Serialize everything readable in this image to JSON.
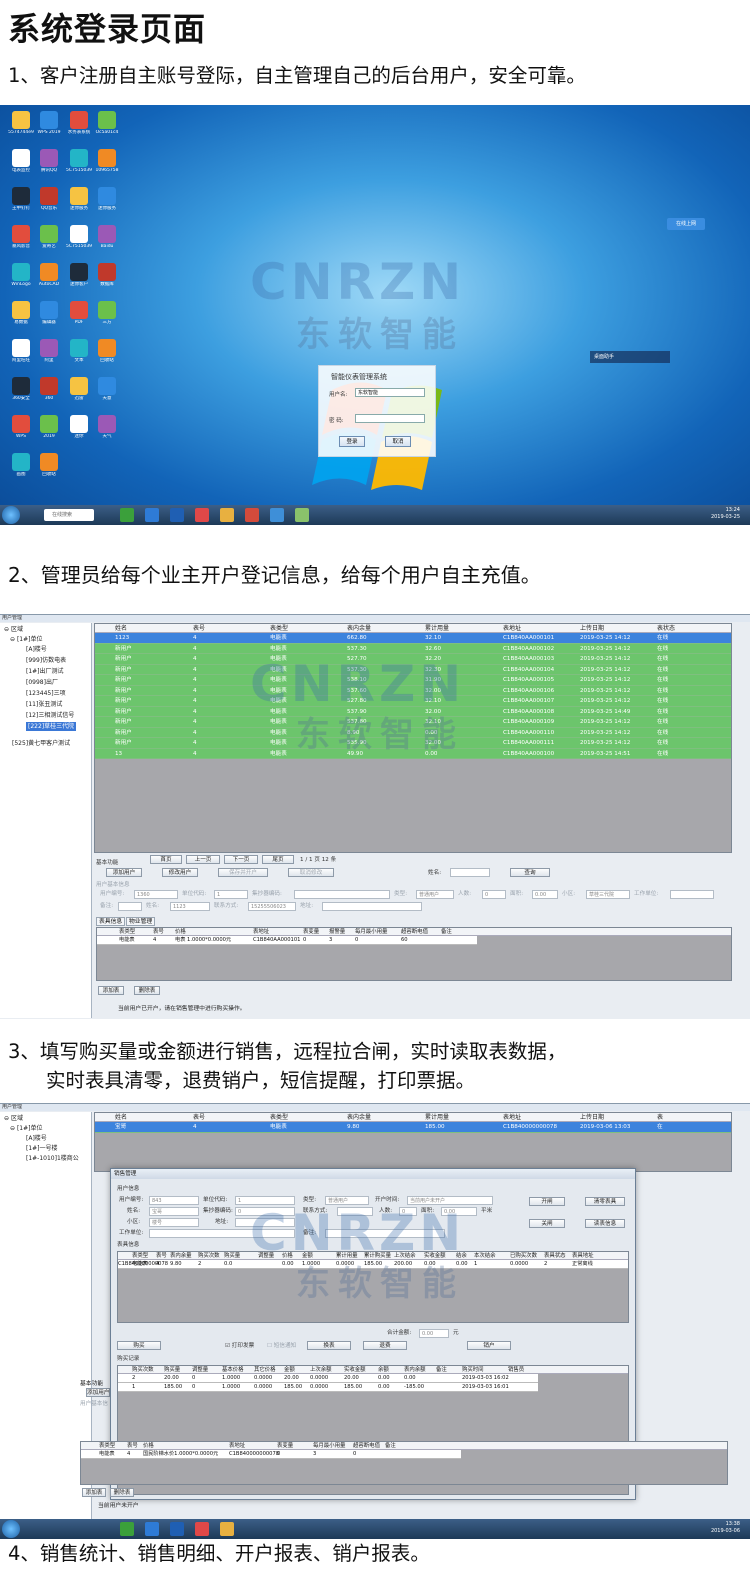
{
  "page": {
    "title": "系统登录页面",
    "step1": "1、客户注册自主账号登际，自主管理自己的后台用户，安全可靠。",
    "step2": "2、管理员给每个业主开户登记信息，给每个用户自主充值。",
    "step3_line1": "3、填写购买量或金额进行销售，远程拉合闸，实时读取表数据，",
    "step3_line2": "实时表具清零，退费销户，短信提醒，打印票据。",
    "step4": "4、销售统计、销售明细、开户报表、销户报表。"
  },
  "watermark": {
    "en": "CNRZN",
    "cn": "东软智能"
  },
  "colors": {
    "selected_row": "#3c83dd",
    "ok_row": "#6cc56c",
    "grid_bg": "#a7a7ab",
    "desktop": "#1a6fc4"
  },
  "desktop": {
    "login": {
      "title": "智能仪表管理系统",
      "user_label": "用户名:",
      "user_value": "东软智能",
      "pwd_label": "密  码:",
      "ok_button": "登录",
      "cancel_button": "取消"
    },
    "widget": "桌面助手",
    "top_button": "在线上网",
    "search_text": "在线搜索",
    "clock_time": "13:24",
    "clock_date": "2019-03-25",
    "icons": [
      "5574744e9",
      "WPS 2019",
      "水务表系统",
      "Oc5a01c4",
      "电表监控",
      "腾讯QQ",
      "5C7515039",
      "10965758",
      "王中钉钉",
      "QQ音乐",
      "迷你服务",
      "迷你服务",
      "暴风影音",
      "爱奇艺",
      "5C7515039",
      "Baidu",
      "WinLogo",
      "AutoCAD",
      "迷你客户",
      "数据库",
      "易数据",
      "编辑器",
      "PDF",
      "三方",
      "阿里旺旺",
      "阿里",
      "文本",
      "回收站",
      "360安全",
      "360",
      "迅雷",
      "天意",
      "WPS",
      "2019",
      "迷你",
      "天气",
      "画图",
      "回收站"
    ]
  },
  "app2": {
    "window_title": "用户管理",
    "tree": {
      "root": "区域",
      "unit": "[1#]单位",
      "items": [
        "[A]楼号",
        "[999]仿数电表",
        "[1#]出厂测试",
        "[0998]出厂",
        "[123445]三项",
        "[11]张丑测试",
        "[12]三相测试信号",
        "[222]草桂三代院"
      ],
      "extra": "[525]黄七甲客户测试"
    },
    "columns": [
      "姓名",
      "表号",
      "表类型",
      "表内余量",
      "累计用量",
      "表地址",
      "上传日期",
      "表状态"
    ],
    "rows": [
      [
        "1123",
        "4",
        "电能表",
        "662.80",
        "32.10",
        "C1B840AA000101",
        "2019-03-25 14:12",
        "在线"
      ],
      [
        "新用户",
        "4",
        "电能表",
        "537.30",
        "32.60",
        "C1B840AA000102",
        "2019-03-25 14:12",
        "在线"
      ],
      [
        "新用户",
        "4",
        "电能表",
        "527.70",
        "32.20",
        "C1B840AA000103",
        "2019-03-25 14:12",
        "在线"
      ],
      [
        "新用户",
        "4",
        "电能表",
        "537.30",
        "32.30",
        "C1B840AA000104",
        "2019-03-25 14:12",
        "在线"
      ],
      [
        "新用户",
        "4",
        "电能表",
        "538.10",
        "31.90",
        "C1B840AA000105",
        "2019-03-25 14:12",
        "在线"
      ],
      [
        "新用户",
        "4",
        "电能表",
        "537.60",
        "32.00",
        "C1B840AA000106",
        "2019-03-25 14:12",
        "在线"
      ],
      [
        "新用户",
        "4",
        "电能表",
        "527.80",
        "32.10",
        "C1B840AA000107",
        "2019-03-25 14:12",
        "在线"
      ],
      [
        "新用户",
        "4",
        "电能表",
        "537.90",
        "32.00",
        "C1B840AA000108",
        "2019-03-25 14:49",
        "在线"
      ],
      [
        "新用户",
        "4",
        "电能表",
        "537.80",
        "32.10",
        "C1B840AA000109",
        "2019-03-25 14:12",
        "在线"
      ],
      [
        "新用户",
        "4",
        "电能表",
        "8.90",
        "0.00",
        "C1B840AA000110",
        "2019-03-25 14:12",
        "在线"
      ],
      [
        "新用户",
        "4",
        "电能表",
        "535.90",
        "32.00",
        "C1B840AA000111",
        "2019-03-25 14:12",
        "在线"
      ],
      [
        "13",
        "4",
        "电能表",
        "49.90",
        "0.00",
        "C1B840AA000100",
        "2019-03-25 14:51",
        "在线"
      ]
    ],
    "pager": {
      "first": "首页",
      "prev": "上一页",
      "next": "下一页",
      "last": "尾页",
      "info": "1 / 1 页 12 条"
    },
    "basic": {
      "section": "基本功能",
      "add_user": "添加用户",
      "edit_user": "修改用户",
      "save_open": "保存并开户",
      "cancel_edit": "取消修改",
      "name_label": "姓名:",
      "query": "查询"
    },
    "form": {
      "section": "用户基本信息",
      "user_no_label": "用户编号:",
      "user_no": "1360",
      "unit_code_label": "单位代码:",
      "unit_code": "1",
      "unit_label": "集抄器编码:",
      "type_label": "类型:",
      "type_value": "普通用户",
      "people_label": "人数:",
      "people": "0",
      "area_label": "面积:",
      "area": "0.00",
      "district_label": "小区:",
      "district": "草桂三代院",
      "work_label": "工作单位:",
      "note_label": "备注:",
      "name_label": "姓名:",
      "name": "1123",
      "contact_label": "联系方式:",
      "contact": "15255506023",
      "addr_label": "地址:"
    },
    "meter_tabs": [
      "表具信息",
      "物业管理"
    ],
    "meter_columns": [
      "表类型",
      "表号",
      "价格",
      "表地址",
      "表变量",
      "报警量",
      "每月最小用量",
      "超容断电值",
      "备注"
    ],
    "meter_row": [
      "电能表",
      "4",
      "电表 1.0000*0.0000元",
      "C1B840AA000101",
      "0",
      "3",
      "0",
      "60",
      ""
    ],
    "add_meter": "添加表",
    "delete_meter": "删除表",
    "status": "当前用户已开户，请在销售管理中进行购买操作。"
  },
  "app3": {
    "window_title": "用户管理",
    "tree": {
      "root": "区域",
      "unit": "[1#]单位",
      "items": [
        "[A]楼号",
        "[1#]一号楼",
        "[1#-1010]1楼商公"
      ]
    },
    "columns": [
      "姓名",
      "表号",
      "表类型",
      "表内余量",
      "累计用量",
      "表地址",
      "上传日期",
      "表"
    ],
    "row": [
      "宝哥",
      "4",
      "电能表",
      "9.80",
      "185.00",
      "C1B840000000078",
      "2019-03-06 13:03",
      "在"
    ],
    "dialog": {
      "title": "销售管理",
      "user_info": "用户信息",
      "user_no_label": "用户编号:",
      "user_no": "843",
      "unit_code_label": "单位代码:",
      "unit_code": "1",
      "type_label": "类型:",
      "type_value": "普通用户",
      "open_time_label": "开户时间:",
      "open_time": "当前用户未开户",
      "name_label": "姓名:",
      "name": "宝哥",
      "unit_label": "集抄器编码:",
      "unit_value": "0",
      "contact_label": "联系方式:",
      "people_label": "人数:",
      "people": "0",
      "area_label": "面积:",
      "area": "0.00",
      "area_unit": "平米",
      "district_label": "小区:",
      "district": "楼号",
      "addr_label": "地址:",
      "work_label": "工作单位:",
      "note_label": "备注:",
      "open_button": "开闸",
      "clear_button": "清零表具",
      "close_button": "关闸",
      "read_button": "读表信息",
      "meter_info": "表具信息",
      "meter_columns": [
        "表类型",
        "表号",
        "表内余量",
        "购买次数",
        "购买量",
        "调整量",
        "价格",
        "金额",
        "累计用量",
        "累计购买量",
        "上次结余",
        "实收金额",
        "结余",
        "本次结余",
        "已购买次数",
        "表具状态",
        "表具地址"
      ],
      "meter_row": [
        "电能表",
        "4",
        "9.80",
        "2",
        "0.0",
        "",
        "0.00",
        "1.0000",
        "0.0000",
        "185.00",
        "200.00",
        "0.00",
        "0.00",
        "1",
        "0.0000",
        "2",
        "正常离线",
        "C1B840000000078"
      ],
      "total_label": "合计金额:",
      "total_value": "0.00",
      "total_unit": "元",
      "buy_button": "购买",
      "print_label": "打印发票",
      "sms_label": "短信通知",
      "change_meter": "换表",
      "refund": "退费",
      "close_account": "销户",
      "record_label": "购买记录",
      "record_columns": [
        "购买次数",
        "购买量",
        "调整量",
        "基本价格",
        "其它价格",
        "金额",
        "上次余额",
        "实收金额",
        "余额",
        "表内余额",
        "备注",
        "购买时间",
        "销售员"
      ],
      "records": [
        [
          "2",
          "20.00",
          "0",
          "1.0000",
          "0.0000",
          "20.00",
          "0.0000",
          "20.00",
          "0.00",
          "0.00",
          "",
          "2019-03-03 16:02",
          ""
        ],
        [
          "1",
          "185.00",
          "0",
          "1.0000",
          "0.0000",
          "185.00",
          "0.0000",
          "185.00",
          "0.00",
          "-185.00",
          "",
          "2019-03-03 16:01",
          ""
        ]
      ]
    },
    "basic": {
      "section": "基本功能",
      "add_user": "添加用户",
      "form_section": "用户基本信"
    },
    "meter_columns": [
      "表类型",
      "表号",
      "价格",
      "表地址",
      "表变量",
      "每月最小用量",
      "超容断电值",
      "备注"
    ],
    "meter_row": [
      "电能表",
      "4",
      "国民阶梯水价1.0000*0.0000元",
      "C1B840000000078",
      "0",
      "3",
      "0",
      ""
    ],
    "add_meter": "添加表",
    "delete_meter": "删除表",
    "status": "当前用户未开户",
    "clock_time": "13:38",
    "clock_date": "2019-03-06"
  }
}
